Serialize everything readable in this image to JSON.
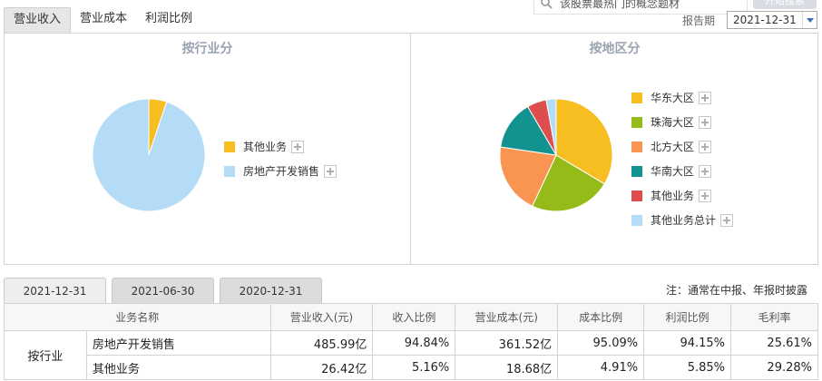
{
  "tabs": [
    {
      "label": "营业收入",
      "active": true
    },
    {
      "label": "营业成本",
      "active": false
    },
    {
      "label": "利润比例",
      "active": false
    }
  ],
  "search": {
    "placeholder": "该股票最热门的概念题材",
    "button_label": "开始搜索"
  },
  "period": {
    "label": "报告期",
    "value": "2021-12-31"
  },
  "charts": {
    "by_industry": {
      "title": "按行业分",
      "legend": [
        {
          "label": "其他业务",
          "color": "#f6be20"
        },
        {
          "label": "房地产开发销售",
          "color": "#b4dcf7"
        }
      ]
    },
    "by_region": {
      "title": "按地区分",
      "legend": [
        {
          "label": "华东大区",
          "color": "#f6be20"
        },
        {
          "label": "珠海大区",
          "color": "#94bb18"
        },
        {
          "label": "北方大区",
          "color": "#f99451"
        },
        {
          "label": "华南大区",
          "color": "#139390"
        },
        {
          "label": "其他业务",
          "color": "#dd4f4f"
        },
        {
          "label": "其他业务总计",
          "color": "#b4dcf7"
        }
      ]
    }
  },
  "chart_data": [
    {
      "type": "pie",
      "title": "按行业分",
      "labels": [
        "其他业务",
        "房地产开发销售"
      ],
      "values": [
        5.16,
        94.84
      ],
      "colors": [
        "#f6be20",
        "#b4dcf7"
      ]
    },
    {
      "type": "pie",
      "title": "按地区分",
      "labels": [
        "华东大区",
        "珠海大区",
        "北方大区",
        "华南大区",
        "其他业务",
        "其他业务总计"
      ],
      "values": [
        33,
        23,
        20,
        14,
        5.5,
        2.8
      ],
      "colors": [
        "#f6be20",
        "#94bb18",
        "#f99451",
        "#139390",
        "#dd4f4f",
        "#b4dcf7"
      ]
    }
  ],
  "date_tabs": [
    {
      "label": "2021-12-31",
      "active": true
    },
    {
      "label": "2021-06-30",
      "active": false
    },
    {
      "label": "2020-12-31",
      "active": false
    }
  ],
  "note": "注：通常在中报、年报时披露",
  "table": {
    "headers": [
      "业务名称",
      "营业收入(元)",
      "收入比例",
      "营业成本(元)",
      "成本比例",
      "利润比例",
      "毛利率"
    ],
    "group": "按行业",
    "rows": [
      [
        "房地产开发销售",
        "485.99亿",
        "94.84%",
        "361.52亿",
        "95.09%",
        "94.15%",
        "25.61%"
      ],
      [
        "其他业务",
        "26.42亿",
        "5.16%",
        "18.68亿",
        "4.91%",
        "5.85%",
        "29.28%"
      ]
    ]
  }
}
